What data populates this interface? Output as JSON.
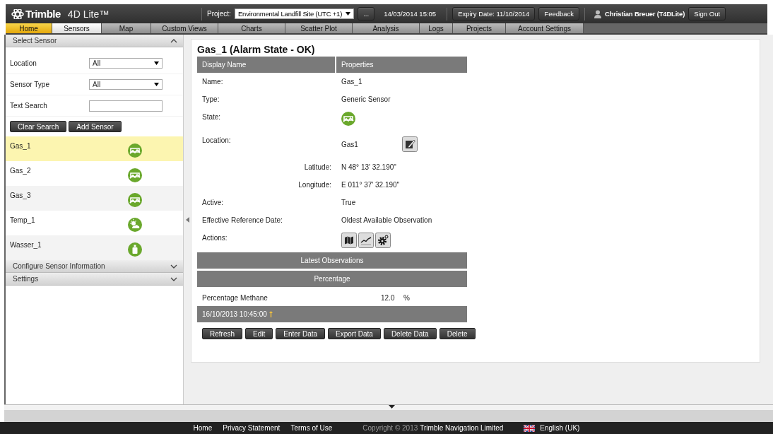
{
  "header": {
    "brand": "Trimble",
    "product": "4D Lite™",
    "project_label": "Project:",
    "project": "Environmental Landfill Site (UTC +1)",
    "more_button": "...",
    "datetime": "14/03/2014 15:05",
    "expiry_button": "Expiry Date: 11/10/2014",
    "feedback_button": "Feedback",
    "user": "Christian Breuer (T4DLite)",
    "sign_out_button": "Sign Out"
  },
  "tabs": [
    {
      "label": "Home",
      "kind": "home",
      "selected": false
    },
    {
      "label": "Sensors",
      "kind": "normal",
      "selected": true
    },
    {
      "label": "Map",
      "kind": "normal",
      "selected": false
    },
    {
      "label": "Custom Views",
      "kind": "normal",
      "selected": false
    },
    {
      "label": "Charts",
      "kind": "normal",
      "selected": false
    },
    {
      "label": "Scatter Plot",
      "kind": "normal",
      "selected": false
    },
    {
      "label": "Analysis",
      "kind": "normal",
      "selected": false
    },
    {
      "label": "Logs",
      "kind": "normal",
      "selected": false
    },
    {
      "label": "Projects",
      "kind": "normal",
      "selected": false
    },
    {
      "label": "Account Settings",
      "kind": "normal",
      "selected": false
    }
  ],
  "sidebar": {
    "title": "Select Sensor",
    "expanded": true,
    "filters": [
      {
        "label": "Location",
        "kind": "select",
        "value": "All"
      },
      {
        "label": "Sensor Type",
        "kind": "select",
        "value": "All"
      },
      {
        "label": "Text Search",
        "kind": "text"
      }
    ],
    "buttons": [
      "Clear Search",
      "Add Sensor"
    ],
    "sensors": [
      {
        "name": "Gas_1",
        "kind": "gas",
        "selected": true
      },
      {
        "name": "Gas_2",
        "kind": "gas",
        "selected": false
      },
      {
        "name": "Gas_3",
        "kind": "gas",
        "selected": false
      },
      {
        "name": "Temp_1",
        "kind": "weather",
        "selected": false
      },
      {
        "name": "Wasser_1",
        "kind": "water",
        "selected": false
      }
    ],
    "sections": [
      {
        "title": "Configure Sensor Information",
        "expanded": false
      },
      {
        "title": "Settings",
        "expanded": false
      }
    ]
  },
  "detail": {
    "title": "Gas_1 (Alarm State - OK)",
    "columns": [
      "Display Name",
      "Properties"
    ],
    "rows": [
      {
        "kind": "text",
        "label": "Name:",
        "value": "Gas_1"
      },
      {
        "kind": "text",
        "label": "Type:",
        "value": "Generic Sensor"
      },
      {
        "kind": "state",
        "label": "State:"
      },
      {
        "kind": "location",
        "label": "Location:",
        "value": "Gas1"
      },
      {
        "kind": "coord",
        "label": "Latitude:",
        "value": "N 48° 13' 32.190\""
      },
      {
        "kind": "coord",
        "label": "Longitude:",
        "value": "E 011° 37' 32.190\""
      },
      {
        "kind": "text",
        "label": "Active:",
        "value": "True"
      },
      {
        "kind": "text",
        "label": "Effective Reference Date:",
        "value": "Oldest Available Observation"
      },
      {
        "kind": "actions",
        "label": "Actions:"
      }
    ],
    "observations_title": "Latest Observations",
    "group_title": "Percentage",
    "observation": {
      "name": "Percentage Methane",
      "value": "12.0",
      "unit": "%"
    },
    "timestamp": "16/10/2013 10:45:00",
    "buttons": [
      "Refresh",
      "Edit",
      "Enter Data",
      "Export Data",
      "Delete Data",
      "Delete"
    ]
  },
  "footer": {
    "links": [
      "Home",
      "Privacy Statement",
      "Terms of Use"
    ],
    "copyright": "Copyright © 2013",
    "company": "Trimble Navigation Limited",
    "language": "English (UK)"
  }
}
